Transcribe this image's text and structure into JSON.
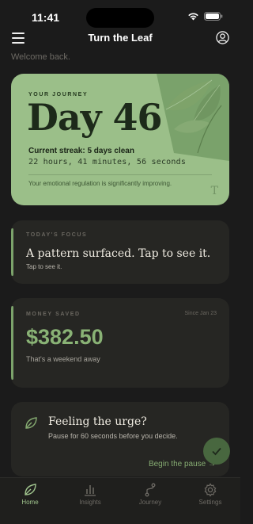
{
  "status_bar": {
    "time": "11:41"
  },
  "nav": {
    "title": "Turn the Leaf"
  },
  "welcome": "Welcome back.",
  "journey": {
    "eyebrow": "YOUR JOURNEY",
    "day": "Day 46",
    "streak": "Current streak: 5 days clean",
    "timer": "22 hours, 41 minutes, 56 seconds",
    "note": "Your emotional regulation is significantly improving.",
    "glyph": "T"
  },
  "focus": {
    "eyebrow": "TODAY'S FOCUS",
    "title": "A pattern surfaced. Tap to see it.",
    "subtitle": "Tap to see it."
  },
  "money": {
    "eyebrow": "MONEY SAVED",
    "since": "Since Jan 23",
    "amount": "$382.50",
    "caption": "That's a weekend away"
  },
  "urge": {
    "title": "Feeling the urge?",
    "subtitle": "Pause for 60 seconds before you decide.",
    "link": "Begin the pause →"
  },
  "tabs": [
    {
      "label": "Home",
      "icon": "leaf-icon"
    },
    {
      "label": "Insights",
      "icon": "bar-chart-icon"
    },
    {
      "label": "Journey",
      "icon": "path-icon"
    },
    {
      "label": "Settings",
      "icon": "gear-icon"
    }
  ],
  "colors": {
    "background": "#1b1b1b",
    "card": "#262623",
    "journey_card": "#9bbf89",
    "accent_green": "#89b275",
    "active_tab": "#9fc38d"
  }
}
